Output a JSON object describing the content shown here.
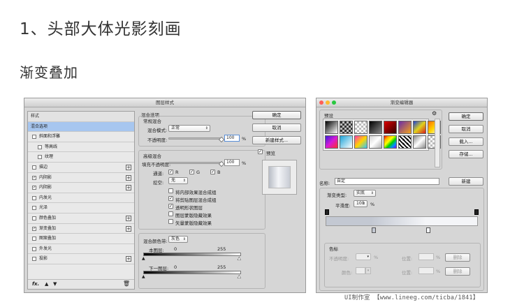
{
  "page": {
    "heading": "1、头部大体光影刻画",
    "subheading": "渐变叠加",
    "footer": "UI制作室 【www.lineeg.com/ticba/1841】"
  },
  "layer_style": {
    "title": "图层样式",
    "styles_header": "样式",
    "items": [
      {
        "label": "混合选项",
        "checkbox": false,
        "checked": false,
        "plus": false,
        "indent": false,
        "selected": true
      },
      {
        "label": "斜面和浮雕",
        "checkbox": true,
        "checked": false,
        "plus": false,
        "indent": false,
        "selected": false
      },
      {
        "label": "等高线",
        "checkbox": true,
        "checked": false,
        "plus": false,
        "indent": true,
        "selected": false
      },
      {
        "label": "纹理",
        "checkbox": true,
        "checked": false,
        "plus": false,
        "indent": true,
        "selected": false
      },
      {
        "label": "描边",
        "checkbox": true,
        "checked": false,
        "plus": true,
        "indent": false,
        "selected": false
      },
      {
        "label": "内阴影",
        "checkbox": true,
        "checked": true,
        "plus": true,
        "indent": false,
        "selected": false
      },
      {
        "label": "内阴影",
        "checkbox": true,
        "checked": true,
        "plus": true,
        "indent": false,
        "selected": false
      },
      {
        "label": "内发光",
        "checkbox": true,
        "checked": false,
        "plus": false,
        "indent": false,
        "selected": false
      },
      {
        "label": "光泽",
        "checkbox": true,
        "checked": false,
        "plus": false,
        "indent": false,
        "selected": false
      },
      {
        "label": "颜色叠加",
        "checkbox": true,
        "checked": false,
        "plus": true,
        "indent": false,
        "selected": false
      },
      {
        "label": "渐变叠加",
        "checkbox": true,
        "checked": true,
        "plus": true,
        "indent": false,
        "selected": false
      },
      {
        "label": "图案叠加",
        "checkbox": true,
        "checked": false,
        "plus": false,
        "indent": false,
        "selected": false
      },
      {
        "label": "外发光",
        "checkbox": true,
        "checked": false,
        "plus": false,
        "indent": false,
        "selected": false
      },
      {
        "label": "投影",
        "checkbox": true,
        "checked": false,
        "plus": true,
        "indent": false,
        "selected": false
      }
    ],
    "footer_fx": "fx.",
    "blend_options": {
      "group_title": "混合选项",
      "general_title": "常规混合",
      "blend_mode_label": "混合模式:",
      "blend_mode_value": "正常",
      "opacity_label": "不透明度:",
      "opacity_value": "100",
      "opacity_unit": "%",
      "opacity_fraction": 1.0,
      "advanced_title": "高级混合",
      "fill_opacity_label": "填充不透明度:",
      "fill_opacity_value": "100",
      "fill_opacity_unit": "%",
      "fill_opacity_fraction": 1.0,
      "channels_label": "通道:",
      "channels": [
        {
          "label": "R",
          "checked": true
        },
        {
          "label": "G",
          "checked": true
        },
        {
          "label": "B",
          "checked": true
        }
      ],
      "knockout_label": "挖空:",
      "knockout_value": "无",
      "options": [
        {
          "label": "将内部效果混合成组",
          "checked": false
        },
        {
          "label": "将剪贴图层混合成组",
          "checked": true
        },
        {
          "label": "透明形状图层",
          "checked": true
        },
        {
          "label": "图层蒙版隐藏效果",
          "checked": false
        },
        {
          "label": "矢量蒙版隐藏效果",
          "checked": false
        }
      ],
      "blend_if_label": "混合颜色带:",
      "blend_if_value": "灰色",
      "this_layer_label": "本图层:",
      "this_layer_min": "0",
      "this_layer_max": "255",
      "underlying_label": "下一图层:",
      "underlying_min": "0",
      "underlying_max": "255"
    },
    "buttons": {
      "ok": "确定",
      "cancel": "取消",
      "new_style": "新建样式...",
      "preview_label": "预览",
      "preview_checked": true
    }
  },
  "gradient_editor": {
    "title": "渐变编辑器",
    "presets_label": "预设",
    "gear_icon": "gear-icon",
    "buttons": {
      "ok": "确定",
      "cancel": "取消",
      "load": "载入...",
      "save": "存储...",
      "new": "新建"
    },
    "name_label": "名称:",
    "name_value": "自定",
    "type_label": "渐变类型:",
    "type_value": "实底",
    "smoothness_label": "平滑度:",
    "smoothness_value": "100",
    "smoothness_unit": "%",
    "gradient_colors": [
      "#c3c8d2",
      "#f4f5f8"
    ],
    "stops_group": "色标",
    "opacity_label": "不透明度:",
    "opacity_unit": "%",
    "location_label": "位置:",
    "location_unit": "%",
    "delete_label": "删除",
    "color_label": "颜色:",
    "preset_swatches": [
      "linear-gradient(135deg,#000,#fff)",
      "checker-dark",
      "checker-light",
      "linear-gradient(135deg,#000,#888)",
      "linear-gradient(135deg,#d00,#300)",
      "linear-gradient(135deg,#6b2ca8,#f2a21c)",
      "linear-gradient(135deg,#1b3fd8,#e0d21c,#d81b1b)",
      "linear-gradient(135deg,#ff6a00,#ffd500,#fff)",
      "linear-gradient(135deg,#3a1cd8,#d61bd6,#ff2d2d)",
      "linear-gradient(135deg,#1ca3d8,#fff)",
      "linear-gradient(135deg,#ff3ab0,#ffd500,#31c7ff)",
      "linear-gradient(135deg,#d4d4d4,#ffffff,#b0b0b0)",
      "linear-gradient(135deg,#ff0000,#ffae00,#ffff00,#00d000,#0090ff,#8000ff)",
      "checker-diag",
      "linear-gradient(135deg,#888,#fff,#888)",
      "checker-light"
    ]
  }
}
